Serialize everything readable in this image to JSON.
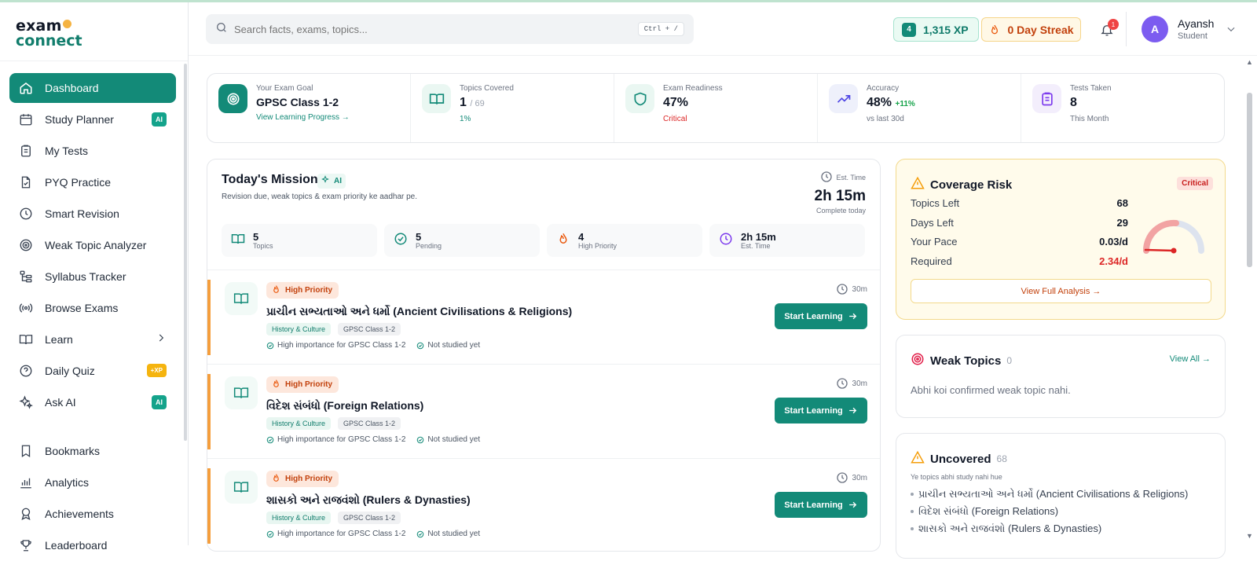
{
  "app": {
    "logo_top": "exam",
    "logo_bottom": "connect"
  },
  "sidebar": {
    "items": [
      {
        "label": "Dashboard",
        "icon": "home-icon",
        "active": true
      },
      {
        "label": "Study Planner",
        "icon": "calendar-icon",
        "badge": "AI"
      },
      {
        "label": "My Tests",
        "icon": "clipboard-icon"
      },
      {
        "label": "PYQ Practice",
        "icon": "file-icon"
      },
      {
        "label": "Smart Revision",
        "icon": "clock-icon"
      },
      {
        "label": "Weak Topic Analyzer",
        "icon": "target-icon"
      },
      {
        "label": "Syllabus Tracker",
        "icon": "tree-icon"
      },
      {
        "label": "Browse Exams",
        "icon": "broadcast-icon"
      },
      {
        "label": "Learn",
        "icon": "book-icon"
      },
      {
        "label": "Daily Quiz",
        "icon": "help-circle-icon",
        "badge": "+XP"
      },
      {
        "label": "Ask AI",
        "icon": "sparkles-icon",
        "badge": "AI"
      }
    ],
    "items2": [
      {
        "label": "Bookmarks",
        "icon": "bookmark-icon"
      },
      {
        "label": "Analytics",
        "icon": "bar-chart-icon"
      },
      {
        "label": "Achievements",
        "icon": "award-icon"
      },
      {
        "label": "Leaderboard",
        "icon": "trophy-icon"
      }
    ]
  },
  "header": {
    "search_placeholder": "Search facts, exams, topics...",
    "shortcut": "Ctrl + /",
    "level": "4",
    "xp": "1,315 XP",
    "streak": "0 Day Streak",
    "notifications": "1",
    "avatar_letter": "A",
    "user_name": "Ayansh",
    "user_role": "Student"
  },
  "stats": [
    {
      "label": "Your Exam Goal",
      "value": "GPSC Class 1-2",
      "sub": "View Learning Progress →",
      "icon": "target-icon"
    },
    {
      "label": "Topics Covered",
      "value": "1",
      "value_suffix": "/ 69",
      "sub": "1%",
      "icon": "book-open-icon"
    },
    {
      "label": "Exam Readiness",
      "value": "47%",
      "sub": "Critical",
      "icon": "shield-icon"
    },
    {
      "label": "Accuracy",
      "value": "48%",
      "value_suffix": "+11%",
      "sub": "vs last 30d",
      "icon": "trending-up-icon"
    },
    {
      "label": "Tests Taken",
      "value": "8",
      "sub": "This Month",
      "icon": "clipboard-icon"
    }
  ],
  "mission": {
    "title": "Today's Mission",
    "ai_badge": "AI",
    "subtitle": "Revision due, weak topics & exam priority ke aadhar pe.",
    "est_label": "Est. Time",
    "est_time": "2h 15m",
    "est_caption": "Complete today",
    "minis": [
      {
        "num": "5",
        "label": "Topics"
      },
      {
        "num": "5",
        "label": "Pending"
      },
      {
        "num": "4",
        "label": "High Priority"
      },
      {
        "num": "2h 15m",
        "label": "Est. Time"
      }
    ],
    "tasks": [
      {
        "priority": "High Priority",
        "title": "પ્રાચીન સભ્યતાઓ અને ધર્મો (Ancient Civilisations & Religions)",
        "tag1": "History & Culture",
        "tag2": "GPSC Class 1-2",
        "meta1": "High importance for GPSC Class 1-2",
        "meta2": "Not studied yet",
        "duration": "30m",
        "button": "Start Learning"
      },
      {
        "priority": "High Priority",
        "title": "વિદેશ સંબંધો (Foreign Relations)",
        "tag1": "History & Culture",
        "tag2": "GPSC Class 1-2",
        "meta1": "High importance for GPSC Class 1-2",
        "meta2": "Not studied yet",
        "duration": "30m",
        "button": "Start Learning"
      },
      {
        "priority": "High Priority",
        "title": "શાસકો અને રાજવંશો (Rulers & Dynasties)",
        "tag1": "History & Culture",
        "tag2": "GPSC Class 1-2",
        "meta1": "High importance for GPSC Class 1-2",
        "meta2": "Not studied yet",
        "duration": "30m",
        "button": "Start Learning"
      }
    ]
  },
  "risk": {
    "title": "Coverage Risk",
    "badge": "Critical",
    "rows": [
      {
        "label": "Topics Left",
        "value": "68"
      },
      {
        "label": "Days Left",
        "value": "29"
      },
      {
        "label": "Your Pace",
        "value": "0.03/d"
      },
      {
        "label": "Required",
        "value": "2.34/d"
      }
    ],
    "link": "View Full Analysis →"
  },
  "weak": {
    "title": "Weak Topics",
    "count": "0",
    "link": "View All →",
    "message": "Abhi koi confirmed weak topic nahi."
  },
  "uncovered": {
    "title": "Uncovered",
    "count": "68",
    "subtitle": "Ye topics abhi study nahi hue",
    "items": [
      "પ્રાચીન સભ્યતાઓ અને ધર્મો (Ancient Civilisations & Religions)",
      "વિદેશ સંબંધો (Foreign Relations)",
      "શાસકો અને રાજવંશો (Rulers & Dynasties)"
    ]
  },
  "colors": {
    "brand": "#138a78",
    "critical": "#dc2626",
    "priority": "#f59e3c"
  }
}
